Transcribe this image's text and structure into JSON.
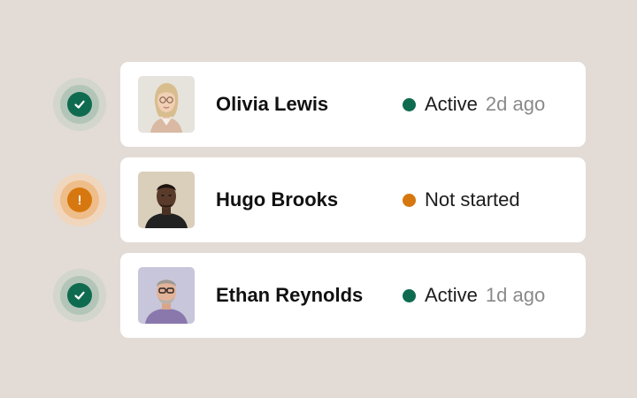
{
  "colors": {
    "background": "#e3dbd5",
    "card": "#ffffff",
    "active": "#0f6b4f",
    "not_started": "#d6780f"
  },
  "users": [
    {
      "name": "Olivia Lewis",
      "status": "Active",
      "time": "2d ago",
      "status_type": "active",
      "indicator_icon": "check-icon"
    },
    {
      "name": "Hugo Brooks",
      "status": "Not started",
      "time": "",
      "status_type": "not_started",
      "indicator_icon": "exclamation-icon"
    },
    {
      "name": "Ethan Reynolds",
      "status": "Active",
      "time": "1d ago",
      "status_type": "active",
      "indicator_icon": "check-icon"
    }
  ]
}
